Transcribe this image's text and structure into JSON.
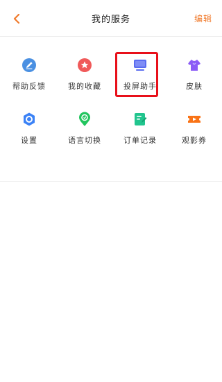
{
  "header": {
    "title": "我的服务",
    "edit_label": "编辑"
  },
  "colors": {
    "accent": "#f07a2c",
    "highlight": "#e8101a"
  },
  "services": [
    {
      "label": "帮助反馈",
      "icon": "pencil-icon",
      "color": "#4a90e2"
    },
    {
      "label": "我的收藏",
      "icon": "star-icon",
      "color": "#f05a5a"
    },
    {
      "label": "投屏助手",
      "icon": "screen-cast-icon",
      "color": "#5b6df0"
    },
    {
      "label": "皮肤",
      "icon": "tshirt-icon",
      "color": "#8b5cf6"
    },
    {
      "label": "设置",
      "icon": "settings-icon",
      "color": "#3b82f6"
    },
    {
      "label": "语言切换",
      "icon": "language-icon",
      "color": "#22c55e"
    },
    {
      "label": "订单记录",
      "icon": "order-icon",
      "color": "#22c58e"
    },
    {
      "label": "观影券",
      "icon": "ticket-icon",
      "color": "#f97316"
    }
  ]
}
